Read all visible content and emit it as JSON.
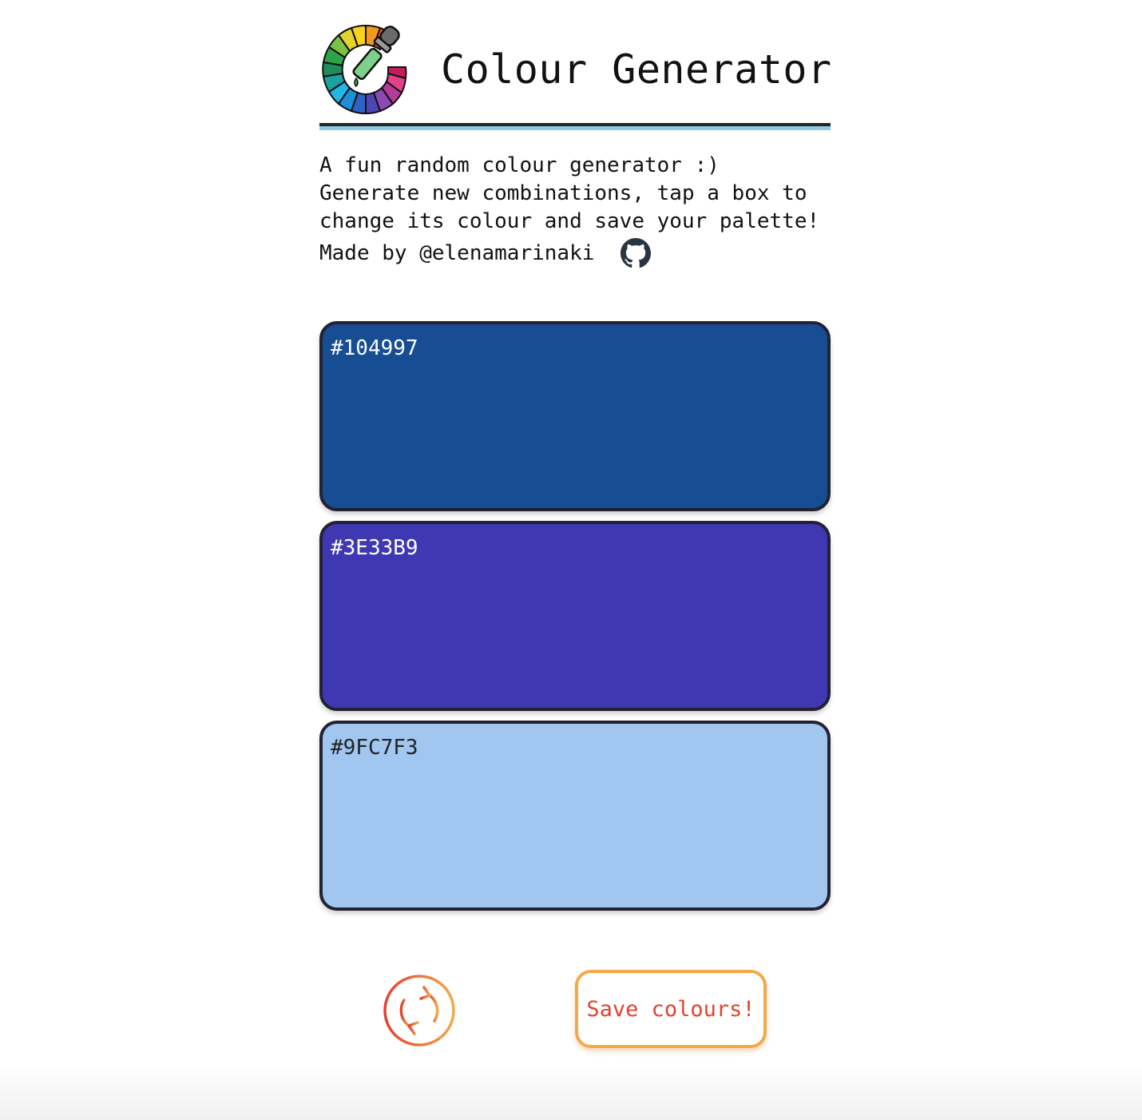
{
  "header": {
    "title": "Colour Generator",
    "logo_icon": "palette-dropper-icon"
  },
  "intro": {
    "line1": "A fun random colour generator :)",
    "line2": "Generate new combinations, tap a box to",
    "line3": "change its colour and save your palette!",
    "made_by": "Made by @elenamarinaki",
    "github_icon": "github-icon"
  },
  "palette": [
    {
      "hex": "#104997",
      "fill": "#174d93",
      "text_color": "#ffffff"
    },
    {
      "hex": "#3E33B9",
      "fill": "#3e39b3",
      "text_color": "#ffffff"
    },
    {
      "hex": "#9FC7F3",
      "fill": "#a1c6f0",
      "text_color": "#222222"
    }
  ],
  "controls": {
    "refresh_icon": "refresh-icon",
    "save_label": "Save colours!"
  },
  "colors": {
    "rule_dark": "#222222",
    "rule_light": "#8ecae6",
    "accent_orange": "#f4a84c",
    "accent_red": "#e2432f"
  }
}
